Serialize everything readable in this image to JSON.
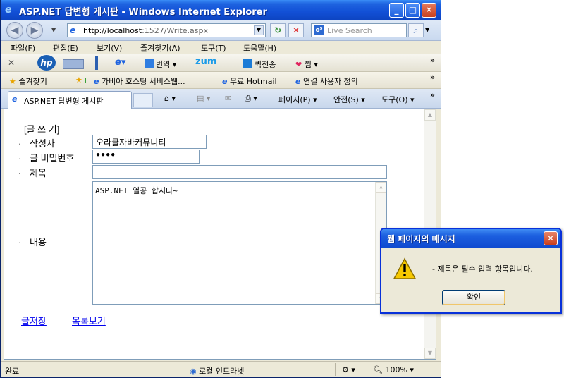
{
  "window": {
    "title": "ASP.NET 답변형 게시판 - Windows Internet Explorer",
    "min_glyph": "_",
    "max_glyph": "□",
    "close_glyph": "✕"
  },
  "address_bar": {
    "url_host": "http://localhost",
    "url_rest": ":1527/Write.aspx",
    "search_placeholder": "Live Search"
  },
  "menu": [
    "파일(F)",
    "편집(E)",
    "보기(V)",
    "즐겨찾기(A)",
    "도구(T)",
    "도움말(H)"
  ],
  "hp_toolbar": {
    "logo": "hp",
    "translate": "번역",
    "zum": "zum",
    "quick_send": "퀵전송",
    "jjim": "찜"
  },
  "favorites_bar": {
    "favorites_label": "즐겨찾기",
    "items": [
      "가비아 호스팅 서비스웹...",
      "무료 Hotmail",
      "연결 사용자 정의"
    ]
  },
  "tab_bar": {
    "active_tab": "ASP.NET 답변형 게시판",
    "page_menu": "페이지(P)",
    "safety_menu": "안전(S)",
    "tools_menu": "도구(O)"
  },
  "form": {
    "heading": "[글 쓰 기]",
    "bullet": "·",
    "author_label": "작성자",
    "author_value": "오라클자바커뮤니티",
    "password_label": "글 비밀번호",
    "password_value": "●●●●",
    "subject_label": "제목",
    "subject_value": "",
    "content_label": "내용",
    "content_value": "ASP.NET 열공 합시다~",
    "save_link": "글저장",
    "list_link": "목록보기"
  },
  "status_bar": {
    "status": "완료",
    "zone": "로컬 인트라넷",
    "zoom": "100%"
  },
  "dialog": {
    "title": "웹 페이지의 메시지",
    "message": "- 제목은 필수 입력 항목입니다.",
    "ok_button": "확인"
  },
  "colors": {
    "titlebar_blue": "#1250d6",
    "link_blue": "#0000ee",
    "warning_yellow": "#f6c800",
    "close_red": "#c83d1c"
  }
}
